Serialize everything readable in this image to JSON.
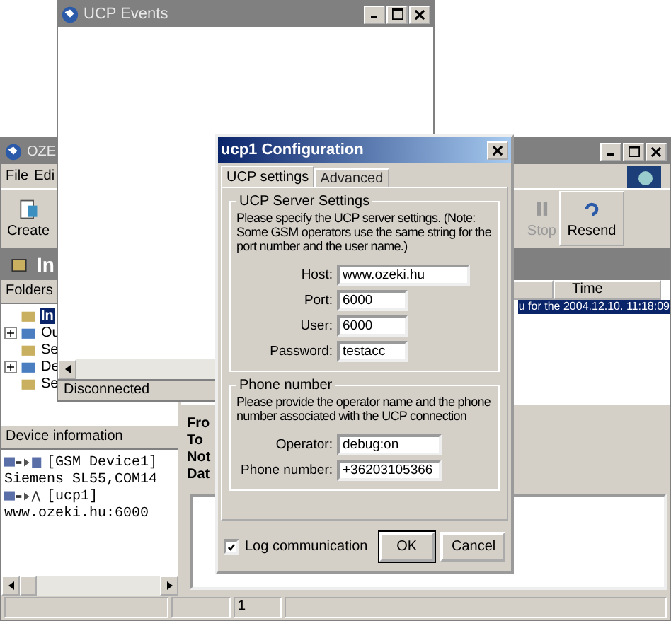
{
  "events_window": {
    "title": "UCP Events",
    "status": "Disconnected"
  },
  "main_window": {
    "title": "OZE",
    "menu": [
      "File",
      "Edi"
    ],
    "toolbar": [
      {
        "label": "Create",
        "kind": "create",
        "disabled": false
      },
      {
        "label": "Stop",
        "kind": "stop",
        "disabled": true
      },
      {
        "label": "Resend",
        "kind": "resend",
        "disabled": false
      }
    ],
    "folder_title": "In",
    "folders": {
      "header": "Folders",
      "items": [
        {
          "label": "In",
          "expandable": false,
          "selected": true
        },
        {
          "label": "Ou",
          "expandable": true,
          "selected": false
        },
        {
          "label": "Se",
          "expandable": false,
          "selected": false
        },
        {
          "label": "De",
          "expandable": true,
          "selected": false
        },
        {
          "label": "Se",
          "expandable": false,
          "selected": false
        }
      ]
    },
    "message_table": {
      "columns": [
        "Time"
      ],
      "rows": [
        {
          "column_1": "u for the",
          "time": "2004.12.10. 11:18:09",
          "selected": true
        }
      ]
    },
    "message_fields": [
      "Fro",
      "To",
      "Not",
      "Dat"
    ],
    "device_info": {
      "header": "Device information",
      "lines": [
        {
          "kind": "device",
          "text": "[GSM Device1]"
        },
        {
          "kind": "detail",
          "text": "Siemens SL55,COM14"
        },
        {
          "kind": "service",
          "text": "[ucp1]"
        },
        {
          "kind": "detail",
          "text": "www.ozeki.hu:6000"
        }
      ]
    },
    "status_bar": [
      "1"
    ]
  },
  "dialog": {
    "title": "ucp1 Configuration",
    "tabs": [
      {
        "label": "UCP settings",
        "selected": true
      },
      {
        "label": "Advanced",
        "selected": false
      }
    ],
    "groups": [
      {
        "title": "UCP Server Settings",
        "description": "Please specify the UCP server settings. (Note: Some GSM operators use the same string for the port number and the user name.)",
        "fields": [
          {
            "label": "Host:",
            "value": "www.ozeki.hu",
            "kind": "wide"
          },
          {
            "label": "Port:",
            "value": "6000",
            "kind": "short"
          },
          {
            "label": "User:",
            "value": "6000",
            "kind": "short"
          },
          {
            "label": "Password:",
            "value": "testacc",
            "kind": "short"
          }
        ]
      },
      {
        "title": "Phone number",
        "description": "Please provide the operator name and the phone number associated with the UCP connection",
        "fields": [
          {
            "label": "Operator:",
            "value": "debug:on",
            "kind": "medium"
          },
          {
            "label": "Phone number:",
            "value": "+36203105366",
            "kind": "medium"
          }
        ]
      }
    ],
    "log_communication": {
      "label": "Log communication",
      "checked": true
    },
    "buttons": [
      "OK",
      "Cancel"
    ]
  }
}
